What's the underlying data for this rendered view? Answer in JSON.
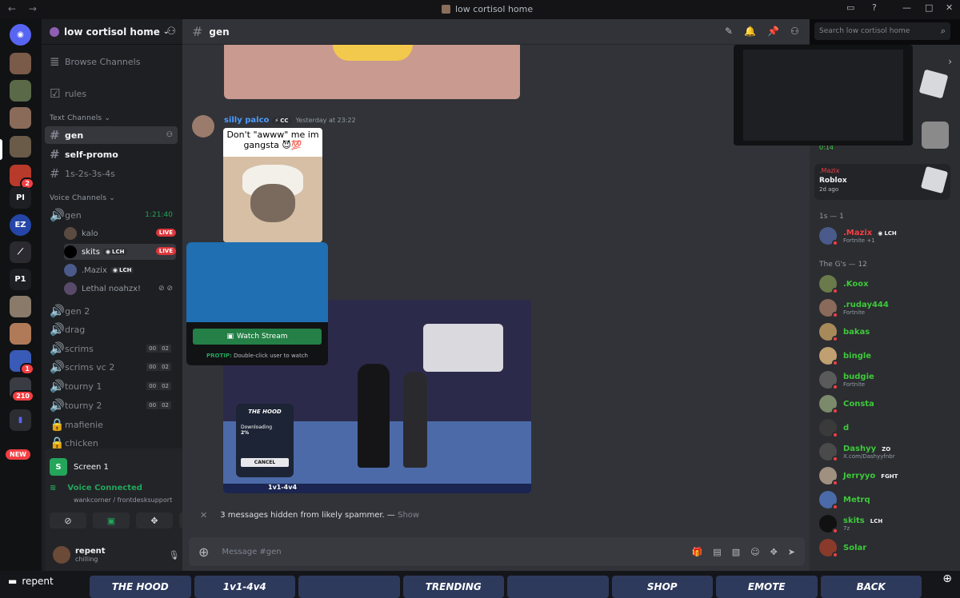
{
  "window": {
    "title": "low cortisol home",
    "nav": "← →"
  },
  "server": {
    "name": "low cortisol home"
  },
  "sidebar": {
    "browse": "Browse Channels",
    "rules": "rules",
    "text_category": "Text Channels",
    "text_channels": [
      "gen",
      "self-promo",
      "1s-2s-3s-4s"
    ],
    "voice_category": "Voice Channels",
    "voice_gen": {
      "name": "gen",
      "timer": "1:21:40"
    },
    "voice_users": [
      {
        "name": "kalo",
        "live": "LIVE"
      },
      {
        "name": "skits",
        "tag": "LCH",
        "live": "LIVE"
      },
      {
        "name": ".Mazix",
        "tag": "LCH"
      },
      {
        "name": "Lethal noahzx!"
      }
    ],
    "voice_channels": [
      {
        "name": "gen 2"
      },
      {
        "name": "drag"
      },
      {
        "name": "scrims",
        "c1": "00",
        "c2": "02"
      },
      {
        "name": "scrims vc 2",
        "c1": "00",
        "c2": "02"
      },
      {
        "name": "tourny 1",
        "c1": "00",
        "c2": "02"
      },
      {
        "name": "tourny 2",
        "c1": "00",
        "c2": "02"
      },
      {
        "name": "mafienie"
      },
      {
        "name": "chicken"
      }
    ]
  },
  "guilds": {
    "badges": [
      "2",
      "1",
      "210"
    ],
    "labels": [
      "PI",
      "EZ",
      "P1"
    ],
    "new_badge": "NEW"
  },
  "bottom_panel": {
    "screen_label": "Screen 1",
    "voice_status": "Voice Connected",
    "voice_sub": "wankcorner / frontdesksupport",
    "user_name": "repent",
    "user_status": "chilling"
  },
  "channel": {
    "name": "gen"
  },
  "search": {
    "placeholder": "Search low cortisol home"
  },
  "message": {
    "author": "silly palco",
    "tag": "CC",
    "time": "Yesterday at 23:22",
    "meme_caption": "Don't \"awww\" me im gangsta 😈💯"
  },
  "stream_popup": {
    "button": "Watch Stream",
    "tip_bold": "PROTIP:",
    "tip_text": "Double-click user to watch"
  },
  "game": {
    "hood_title": "THE HOOD",
    "downloading": "Downloading",
    "percent": "2%",
    "cancel": "CANCEL",
    "map_name": "1v1-4v4"
  },
  "hidden_messages": {
    "text": "3 messages hidden from likely spammer. —",
    "show": "Show"
  },
  "composer": {
    "placeholder": "Message #gen"
  },
  "members": {
    "activity_time": "0:14",
    "activity_user": ".Mazix",
    "activity_title": "Roblox",
    "activity_ago": "2d ago",
    "group_1s": "1s — 1",
    "mazix": {
      "name": ".Mazix",
      "tag": "LCH",
      "sub": "Fortnite +1"
    },
    "group_gs": "The G's — 12",
    "list": [
      {
        "name": ".Koox",
        "sub": ""
      },
      {
        "name": ".ruday444",
        "sub": "Fortnite"
      },
      {
        "name": "bakas",
        "sub": ""
      },
      {
        "name": "bingle",
        "sub": ""
      },
      {
        "name": "budgie",
        "sub": "Fortnite"
      },
      {
        "name": "Consta",
        "sub": ""
      },
      {
        "name": "d",
        "sub": ""
      },
      {
        "name": "Dashyy",
        "sub": "X.com/Dashyyfnbr",
        "tag": "ZO"
      },
      {
        "name": "Jerryyo",
        "sub": "",
        "tag": "FGHT"
      },
      {
        "name": "Metrq",
        "sub": ""
      },
      {
        "name": "skits",
        "sub": "7z",
        "tag": "LCH"
      },
      {
        "name": "Solar",
        "sub": ""
      }
    ]
  },
  "taskbar": {
    "app": "repent",
    "thumbs": [
      "THE HOOD",
      "1v1-4v4",
      "",
      "TRENDING",
      "",
      "SHOP",
      "EMOTE",
      "BACK"
    ]
  }
}
